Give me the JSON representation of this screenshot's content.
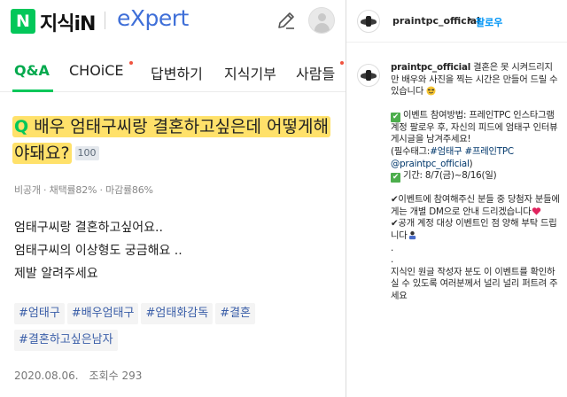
{
  "kin": {
    "logo_letter": "N",
    "service_name": "지식iN",
    "expert_label": "eXpert",
    "tabs": [
      {
        "label": "Q&A"
      },
      {
        "label": "CHOiCE"
      },
      {
        "label": "답변하기"
      },
      {
        "label": "지식기부"
      },
      {
        "label": "사람들"
      }
    ],
    "active_tab": "Q&A",
    "accent_color": "#03c75a",
    "question": {
      "q_mark": "Q",
      "title": "배우 엄태구씨랑 결혼하고싶은데 어떻게해야돼요?",
      "points": "100",
      "meta": "비공개 · 채택률82% · 마감률86%",
      "body": [
        "엄태구씨랑 결혼하고싶어요..",
        "엄태구씨의 이상형도 궁금해요 ..",
        "제발 알려주세요"
      ],
      "tags": [
        "#엄태구",
        "#배우엄태구",
        "#엄태화감독",
        "#결혼",
        "#결혼하고싶은남자"
      ],
      "date": "2020.08.06.",
      "views": "조회수 293"
    }
  },
  "instagram": {
    "username": "praintpc_official",
    "separator": "•",
    "follow_label": "팔로우",
    "follow_color": "#0095f6",
    "caption": {
      "username": "praintpc_official",
      "intro": "결혼은 못 시켜드리지만 배우와 사진을 찍는 시간은 만들어 드릴 수 있습니다",
      "method": "이벤트 참여방법: 프레인TPC 인스타그램 계정 팔로우 후, 자신의 피드에 엄태구 인터뷰 게시글을 남겨주세요!",
      "required_tags_label": "(필수태그:",
      "required_tag_1": "#엄태구",
      "required_tag_2": "#프레인TPC",
      "required_mention": "@praintpc_official",
      "required_close": ")",
      "period": "기간: 8/7(금)~8/16(일)",
      "note_1": "✔이벤트에 참여해주신 분들 중 당첨자 분들에게는 개별 DM으로 안내 드리겠습니다",
      "note_2": "✔공개 계정 대상 이벤트인 점 양해 부탁 드립니다",
      "dots": [
        ".",
        "."
      ],
      "closing": "지식인 원글 작성자 분도 이 이벤트를 확인하실 수 있도록 여러분께서 널리 널리 퍼트려 주세요"
    }
  }
}
